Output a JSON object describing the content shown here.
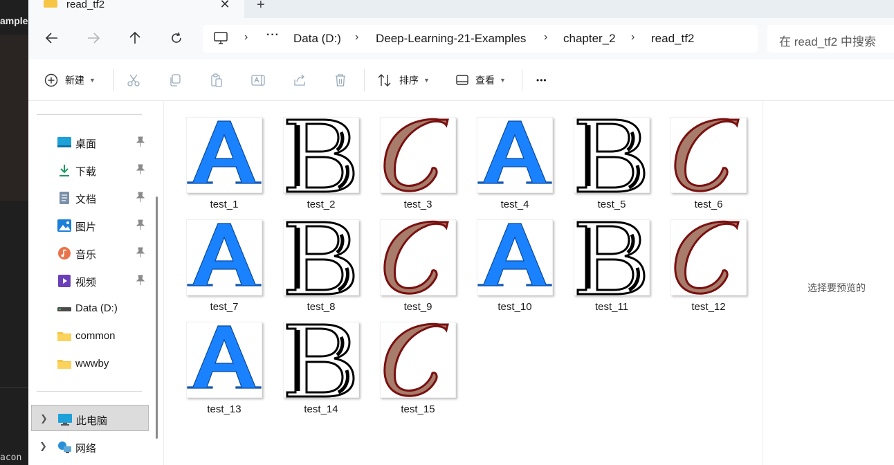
{
  "background_window": {
    "title_fragment": "ample",
    "bottom_fragment": "acon"
  },
  "tab": {
    "title": "read_tf2",
    "close": "✕",
    "new": "+"
  },
  "address": {
    "ellipsis": "···",
    "crumbs": [
      "Data (D:)",
      "Deep-Learning-21-Examples",
      "chapter_2",
      "read_tf2"
    ],
    "separator": "›"
  },
  "search": {
    "placeholder": "在 read_tf2 中搜索"
  },
  "commands": {
    "new": "新建",
    "sort": "排序",
    "view": "查看",
    "more": "•••"
  },
  "sidebar": {
    "quick": [
      {
        "label": "桌面",
        "icon": "desktop-icon"
      },
      {
        "label": "下载",
        "icon": "download-icon"
      },
      {
        "label": "文档",
        "icon": "document-icon"
      },
      {
        "label": "图片",
        "icon": "pictures-icon"
      },
      {
        "label": "音乐",
        "icon": "music-icon"
      },
      {
        "label": "视频",
        "icon": "video-icon"
      }
    ],
    "drives": [
      {
        "label": "Data (D:)",
        "icon": "drive-icon"
      },
      {
        "label": "common",
        "icon": "folder-icon"
      },
      {
        "label": "wwwby",
        "icon": "folder-icon"
      }
    ],
    "this_pc": "此电脑",
    "network": "网络"
  },
  "files": [
    {
      "name": "test_1",
      "letter": "A"
    },
    {
      "name": "test_2",
      "letter": "B"
    },
    {
      "name": "test_3",
      "letter": "C"
    },
    {
      "name": "test_4",
      "letter": "A"
    },
    {
      "name": "test_5",
      "letter": "B"
    },
    {
      "name": "test_6",
      "letter": "C"
    },
    {
      "name": "test_7",
      "letter": "A"
    },
    {
      "name": "test_8",
      "letter": "B"
    },
    {
      "name": "test_9",
      "letter": "C"
    },
    {
      "name": "test_10",
      "letter": "A"
    },
    {
      "name": "test_11",
      "letter": "B"
    },
    {
      "name": "test_12",
      "letter": "C"
    },
    {
      "name": "test_13",
      "letter": "A"
    },
    {
      "name": "test_14",
      "letter": "B"
    },
    {
      "name": "test_15",
      "letter": "C"
    }
  ],
  "preview_pane": {
    "text": "选择要预览的"
  },
  "colors": {
    "letter_a": "#1a82ff",
    "letter_c_fill": "#a77c6b",
    "letter_c_stroke": "#7a1010",
    "accent": "#0067c0"
  }
}
